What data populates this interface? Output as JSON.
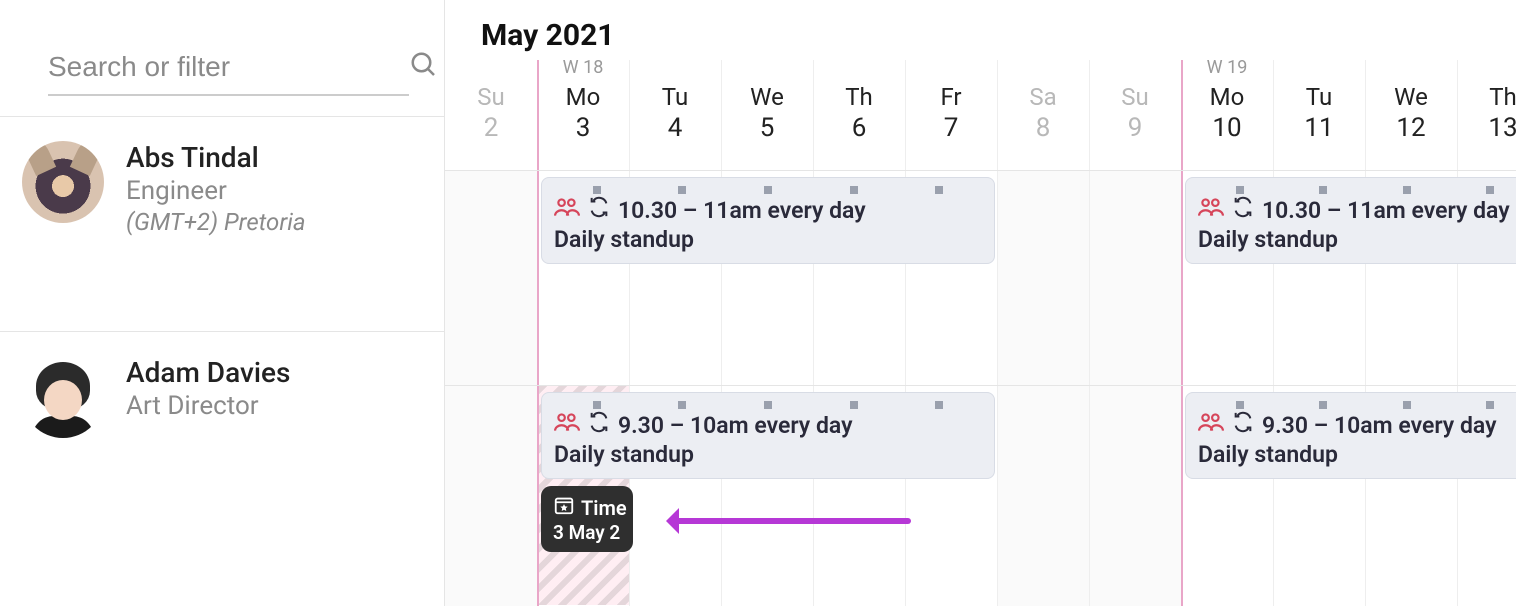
{
  "search": {
    "placeholder": "Search or filter"
  },
  "month_label": "May 2021",
  "people": [
    {
      "name": "Abs Tindal",
      "role": "Engineer",
      "tz": "(GMT+2) Pretoria"
    },
    {
      "name": "Adam Davies",
      "role": "Art Director",
      "tz": ""
    }
  ],
  "weeks": [
    {
      "label": "W 18"
    },
    {
      "label": "W 19"
    }
  ],
  "days": [
    {
      "dow": "Su",
      "num": "2",
      "weekend": true
    },
    {
      "dow": "Mo",
      "num": "3",
      "weekend": false
    },
    {
      "dow": "Tu",
      "num": "4",
      "weekend": false
    },
    {
      "dow": "We",
      "num": "5",
      "weekend": false
    },
    {
      "dow": "Th",
      "num": "6",
      "weekend": false
    },
    {
      "dow": "Fr",
      "num": "7",
      "weekend": false
    },
    {
      "dow": "Sa",
      "num": "8",
      "weekend": true
    },
    {
      "dow": "Su",
      "num": "9",
      "weekend": true
    },
    {
      "dow": "Mo",
      "num": "10",
      "weekend": false
    },
    {
      "dow": "Tu",
      "num": "11",
      "weekend": false
    },
    {
      "dow": "We",
      "num": "12",
      "weekend": false
    },
    {
      "dow": "Th",
      "num": "13",
      "weekend": false
    }
  ],
  "events": {
    "abs_w18": {
      "time": "10.30 – 11am every day",
      "title": "Daily standup"
    },
    "abs_w19": {
      "time": "10.30 – 11am every day",
      "title": "Daily standup"
    },
    "adam_w18": {
      "time": "9.30 – 10am every day",
      "title": "Daily standup"
    },
    "adam_w19": {
      "time": "9.30 – 10am every day",
      "title": "Daily standup"
    }
  },
  "tooltip": {
    "title": "Time",
    "date": "3 May 2"
  }
}
